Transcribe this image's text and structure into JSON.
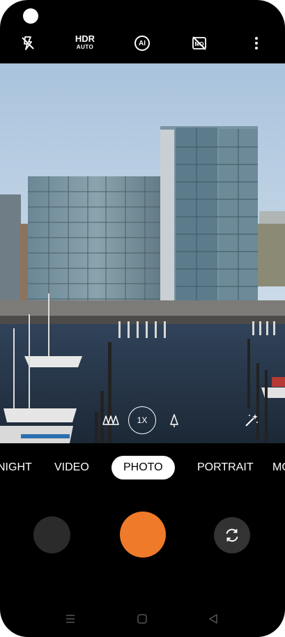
{
  "top_bar": {
    "hdr": "HDR",
    "hdr_sub": "AUTO",
    "ai": "AI"
  },
  "lens_row": {
    "zoom": "1X"
  },
  "modes": [
    {
      "label": "NIGHT"
    },
    {
      "label": "VIDEO"
    },
    {
      "label": "PHOTO"
    },
    {
      "label": "PORTRAIT"
    },
    {
      "label": "MO"
    }
  ],
  "colors": {
    "shutter": "#ee7a2a",
    "background": "#000000",
    "active_mode_bg": "#ffffff"
  },
  "icons": {
    "flash": "flash-off-icon",
    "hdr": "hdr-auto-icon",
    "ai": "ai-icon",
    "motion": "motion-off-icon",
    "more": "more-vertical-icon",
    "wide": "wide-angle-icon",
    "tele": "telephoto-icon",
    "beauty": "magic-wand-icon",
    "flip": "switch-camera-icon"
  }
}
